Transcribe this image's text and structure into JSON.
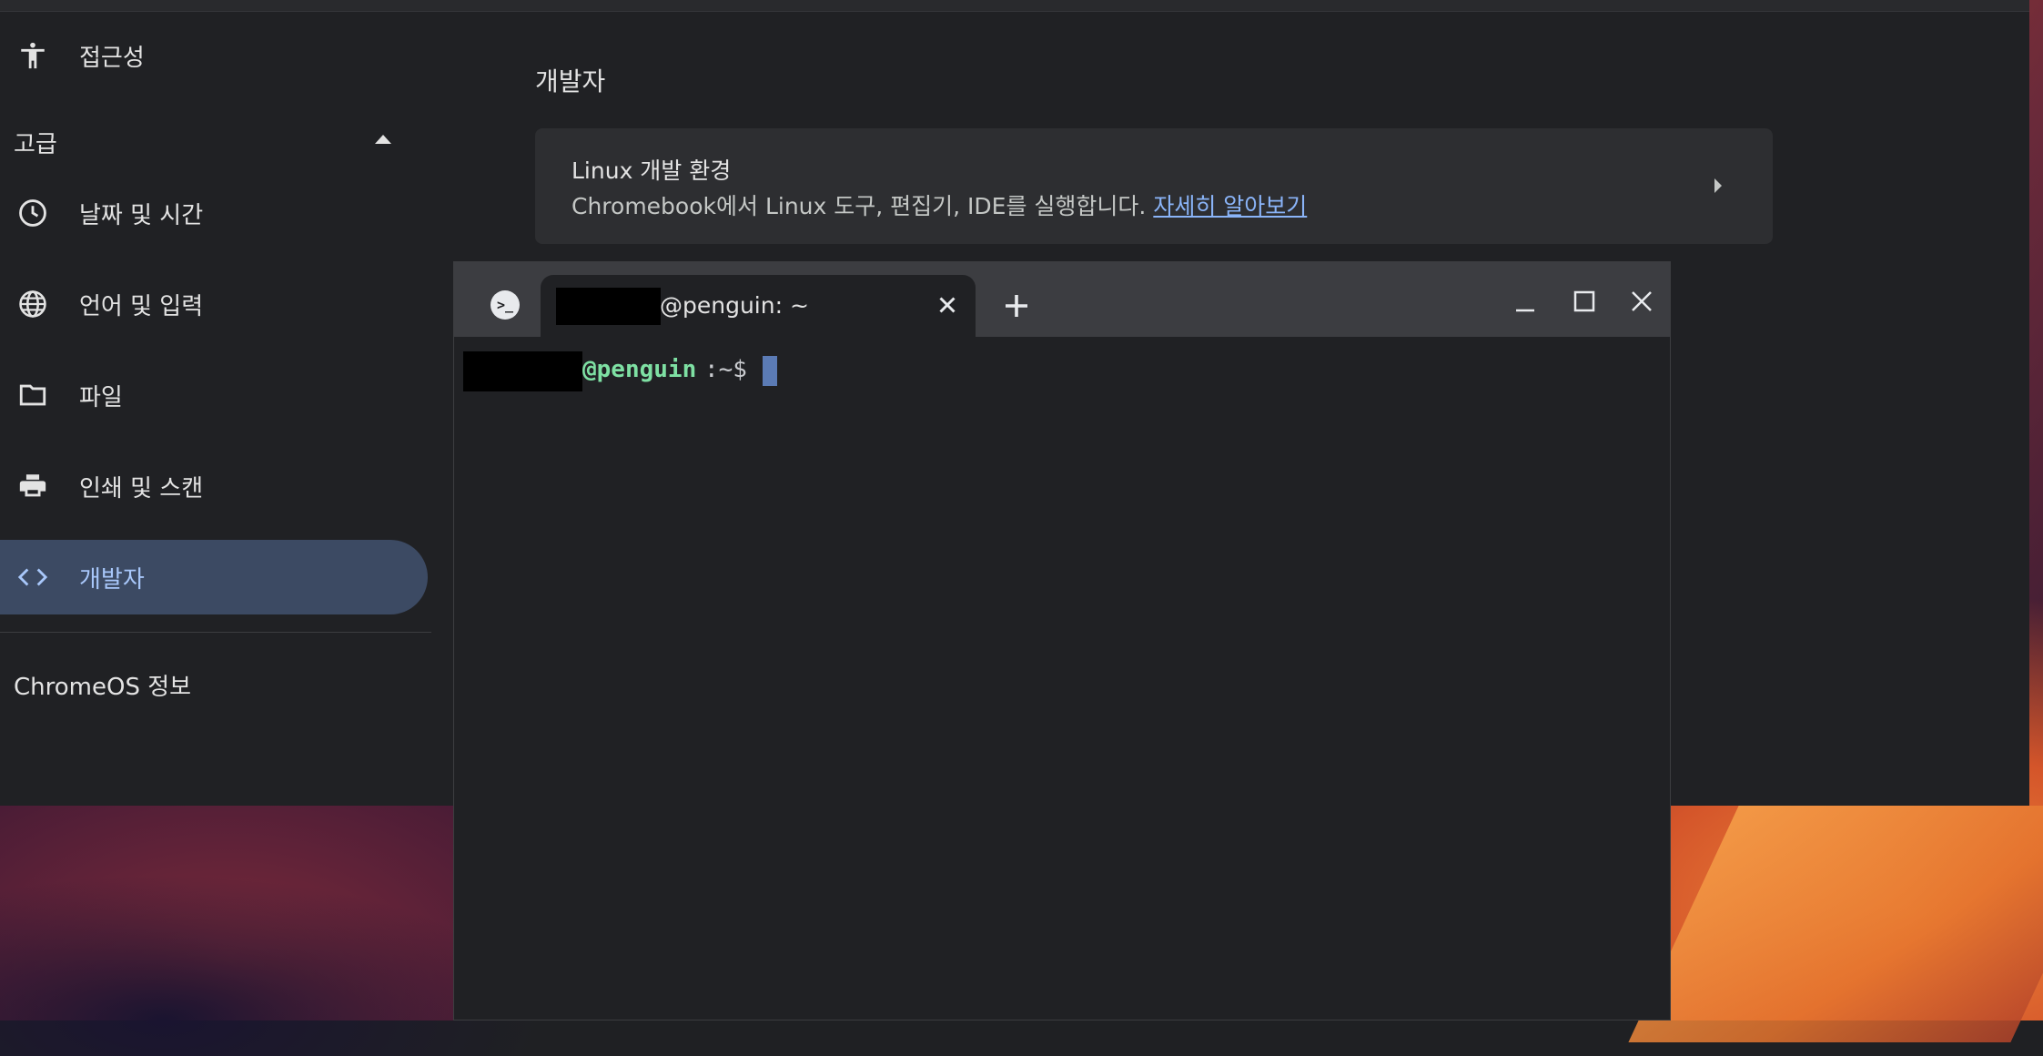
{
  "settings": {
    "nav_items": [
      {
        "label": "접근성",
        "icon": "accessibility-icon"
      },
      {
        "label": "날짜 및 시간",
        "icon": "clock-icon"
      },
      {
        "label": "언어 및 입력",
        "icon": "globe-icon"
      },
      {
        "label": "파일",
        "icon": "folder-icon"
      },
      {
        "label": "인쇄 및 스캔",
        "icon": "printer-icon"
      },
      {
        "label": "개발자",
        "icon": "code-icon"
      }
    ],
    "advanced_label": "고급",
    "about_label": "ChromeOS 정보",
    "section_title": "개발자",
    "linux_card": {
      "title": "Linux 개발 환경",
      "description": "Chromebook에서 Linux 도구, 편집기, IDE를 실행합니다.",
      "link": "자세히 알아보기"
    }
  },
  "terminal": {
    "tab_title": "@penguin: ~",
    "prompt_host": "@penguin",
    "prompt_suffix": ":~$",
    "app_icon_glyph": ">_"
  },
  "colors": {
    "accent": "#a8c7fa",
    "link": "#8ab4f8",
    "prompt_green": "#7ee0a3",
    "active_nav_bg": "#3c4a63",
    "cursor": "#5b7bb5"
  }
}
